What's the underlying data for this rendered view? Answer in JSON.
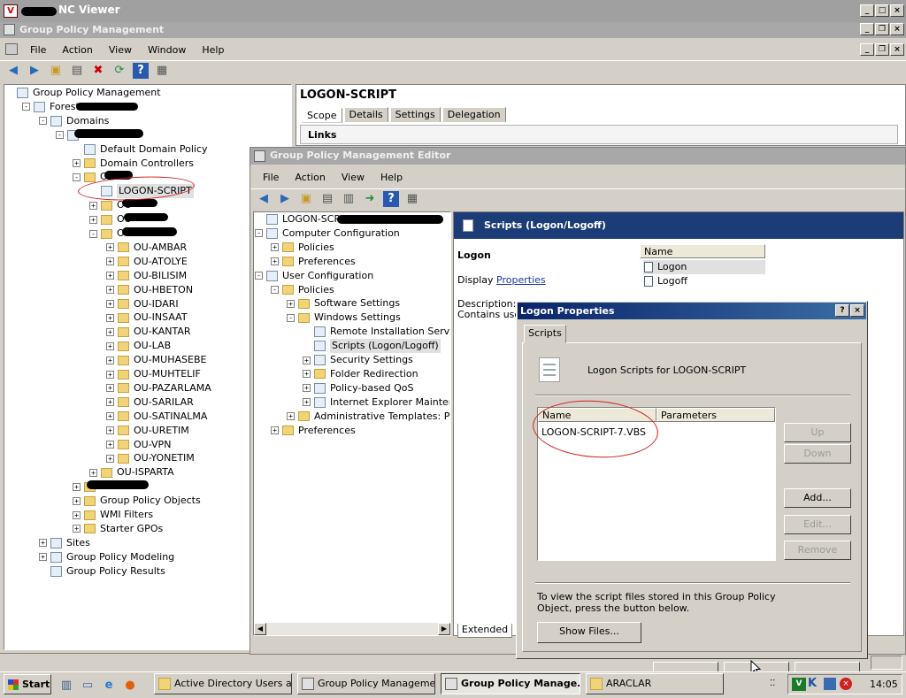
{
  "vnc": {
    "title": "NC Viewer"
  },
  "gpm": {
    "title": "Group Policy Management",
    "menu": [
      "File",
      "Action",
      "View",
      "Window",
      "Help"
    ],
    "tree": [
      {
        "label": "Group Policy Management",
        "level": 0,
        "exp": "",
        "icon": "gpm-icon"
      },
      {
        "label": "Forest:",
        "level": 1,
        "exp": "−",
        "icon": "forest-icon"
      },
      {
        "label": "Domains",
        "level": 2,
        "exp": "−",
        "icon": "domains-icon"
      },
      {
        "label": "",
        "level": 3,
        "exp": "−",
        "icon": "domain-icon"
      },
      {
        "label": "Default Domain Policy",
        "level": 4,
        "exp": "",
        "icon": "gpo-link-icon"
      },
      {
        "label": "Domain Controllers",
        "level": 4,
        "exp": "+",
        "icon": "folder-icon"
      },
      {
        "label": "OU-",
        "level": 4,
        "exp": "−",
        "icon": "folder-icon"
      },
      {
        "label": "LOGON-SCRIPT",
        "level": 5,
        "exp": "",
        "icon": "gpo-link-icon"
      },
      {
        "label": "OU-",
        "level": 5,
        "exp": "+",
        "icon": "folder-icon"
      },
      {
        "label": "OU-",
        "level": 5,
        "exp": "+",
        "icon": "folder-icon"
      },
      {
        "label": "OU-",
        "level": 5,
        "exp": "−",
        "icon": "folder-icon"
      },
      {
        "label": "OU-AMBAR",
        "level": 6,
        "exp": "+",
        "icon": "folder-icon"
      },
      {
        "label": "OU-ATOLYE",
        "level": 6,
        "exp": "+",
        "icon": "folder-icon"
      },
      {
        "label": "OU-BILISIM",
        "level": 6,
        "exp": "+",
        "icon": "folder-icon"
      },
      {
        "label": "OU-HBETON",
        "level": 6,
        "exp": "+",
        "icon": "folder-icon"
      },
      {
        "label": "OU-IDARI",
        "level": 6,
        "exp": "+",
        "icon": "folder-icon"
      },
      {
        "label": "OU-INSAAT",
        "level": 6,
        "exp": "+",
        "icon": "folder-icon"
      },
      {
        "label": "OU-KANTAR",
        "level": 6,
        "exp": "+",
        "icon": "folder-icon"
      },
      {
        "label": "OU-LAB",
        "level": 6,
        "exp": "+",
        "icon": "folder-icon"
      },
      {
        "label": "OU-MUHASEBE",
        "level": 6,
        "exp": "+",
        "icon": "folder-icon"
      },
      {
        "label": "OU-MUHTELIF",
        "level": 6,
        "exp": "+",
        "icon": "folder-icon"
      },
      {
        "label": "OU-PAZARLAMA",
        "level": 6,
        "exp": "+",
        "icon": "folder-icon"
      },
      {
        "label": "OU-SARILAR",
        "level": 6,
        "exp": "+",
        "icon": "folder-icon"
      },
      {
        "label": "OU-SATINALMA",
        "level": 6,
        "exp": "+",
        "icon": "folder-icon"
      },
      {
        "label": "OU-URETIM",
        "level": 6,
        "exp": "+",
        "icon": "folder-icon"
      },
      {
        "label": "OU-VPN",
        "level": 6,
        "exp": "+",
        "icon": "folder-icon"
      },
      {
        "label": "OU-YONETIM",
        "level": 6,
        "exp": "+",
        "icon": "folder-icon"
      },
      {
        "label": "OU-ISPARTA",
        "level": 5,
        "exp": "+",
        "icon": "folder-icon"
      },
      {
        "label": "",
        "level": 4,
        "exp": "+",
        "icon": "folder-icon"
      },
      {
        "label": "Group Policy Objects",
        "level": 4,
        "exp": "+",
        "icon": "folder-icon"
      },
      {
        "label": "WMI Filters",
        "level": 4,
        "exp": "+",
        "icon": "folder-icon"
      },
      {
        "label": "Starter GPOs",
        "level": 4,
        "exp": "+",
        "icon": "folder-icon"
      },
      {
        "label": "Sites",
        "level": 2,
        "exp": "+",
        "icon": "sites-icon"
      },
      {
        "label": "Group Policy Modeling",
        "level": 2,
        "exp": "+",
        "icon": "modeling-icon"
      },
      {
        "label": "Group Policy Results",
        "level": 2,
        "exp": "",
        "icon": "results-icon"
      }
    ],
    "right_title": "LOGON-SCRIPT",
    "tabs": [
      "Scope",
      "Details",
      "Settings",
      "Delegation"
    ],
    "links_label": "Links"
  },
  "editor": {
    "title": "Group Policy Management Editor",
    "menu": [
      "File",
      "Action",
      "View",
      "Help"
    ],
    "tree": [
      {
        "label": "LOGON-SCRIP",
        "level": 0,
        "exp": "",
        "icon": "gpo-icon"
      },
      {
        "label": "Computer Configuration",
        "level": 0,
        "exp": "−",
        "icon": "computer-icon"
      },
      {
        "label": "Policies",
        "level": 1,
        "exp": "+",
        "icon": "folder-icon"
      },
      {
        "label": "Preferences",
        "level": 1,
        "exp": "+",
        "icon": "folder-icon"
      },
      {
        "label": "User Configuration",
        "level": 0,
        "exp": "−",
        "icon": "user-icon"
      },
      {
        "label": "Policies",
        "level": 1,
        "exp": "−",
        "icon": "folder-icon"
      },
      {
        "label": "Software Settings",
        "level": 2,
        "exp": "+",
        "icon": "folder-icon"
      },
      {
        "label": "Windows Settings",
        "level": 2,
        "exp": "−",
        "icon": "folder-icon"
      },
      {
        "label": "Remote Installation Servic",
        "level": 3,
        "exp": "",
        "icon": "remote-icon"
      },
      {
        "label": "Scripts (Logon/Logoff)",
        "level": 3,
        "exp": "",
        "icon": "scripts-icon"
      },
      {
        "label": "Security Settings",
        "level": 3,
        "exp": "+",
        "icon": "security-icon"
      },
      {
        "label": "Folder Redirection",
        "level": 3,
        "exp": "+",
        "icon": "folder-icon"
      },
      {
        "label": "Policy-based QoS",
        "level": 3,
        "exp": "+",
        "icon": "qos-icon"
      },
      {
        "label": "Internet Explorer Mainter",
        "level": 3,
        "exp": "+",
        "icon": "ie-icon"
      },
      {
        "label": "Administrative Templates: Pol",
        "level": 2,
        "exp": "+",
        "icon": "folder-icon"
      },
      {
        "label": "Preferences",
        "level": 1,
        "exp": "+",
        "icon": "folder-icon"
      }
    ],
    "right_header": "Scripts (Logon/Logoff)",
    "section_title": "Logon",
    "display_prefix": "Display",
    "display_link": "Properties",
    "description_label": "Description:",
    "contains_label": "Contains user",
    "list_header": "Name",
    "list_items": [
      "Logon",
      "Logoff"
    ],
    "extended_tab": "Extended"
  },
  "dialog": {
    "title": "Logon Properties",
    "help_btn": "?",
    "close_btn": "×",
    "tab": "Scripts",
    "heading": "Logon Scripts for LOGON-SCRIPT",
    "columns": [
      "Name",
      "Parameters"
    ],
    "rows": [
      [
        "LOGON-SCRIPT-7.VBS",
        ""
      ]
    ],
    "buttons": {
      "up": "Up",
      "down": "Down",
      "add": "Add...",
      "edit": "Edit...",
      "remove": "Remove"
    },
    "info": "To view the script files stored in this Group Policy Object, press the button below.",
    "show_files": "Show Files..."
  },
  "taskbar": {
    "start": "Start",
    "items": [
      "Active Directory Users a...",
      "Group Policy Management",
      "Group Policy Manage...",
      "ARACLAR"
    ],
    "time": "14:05"
  }
}
